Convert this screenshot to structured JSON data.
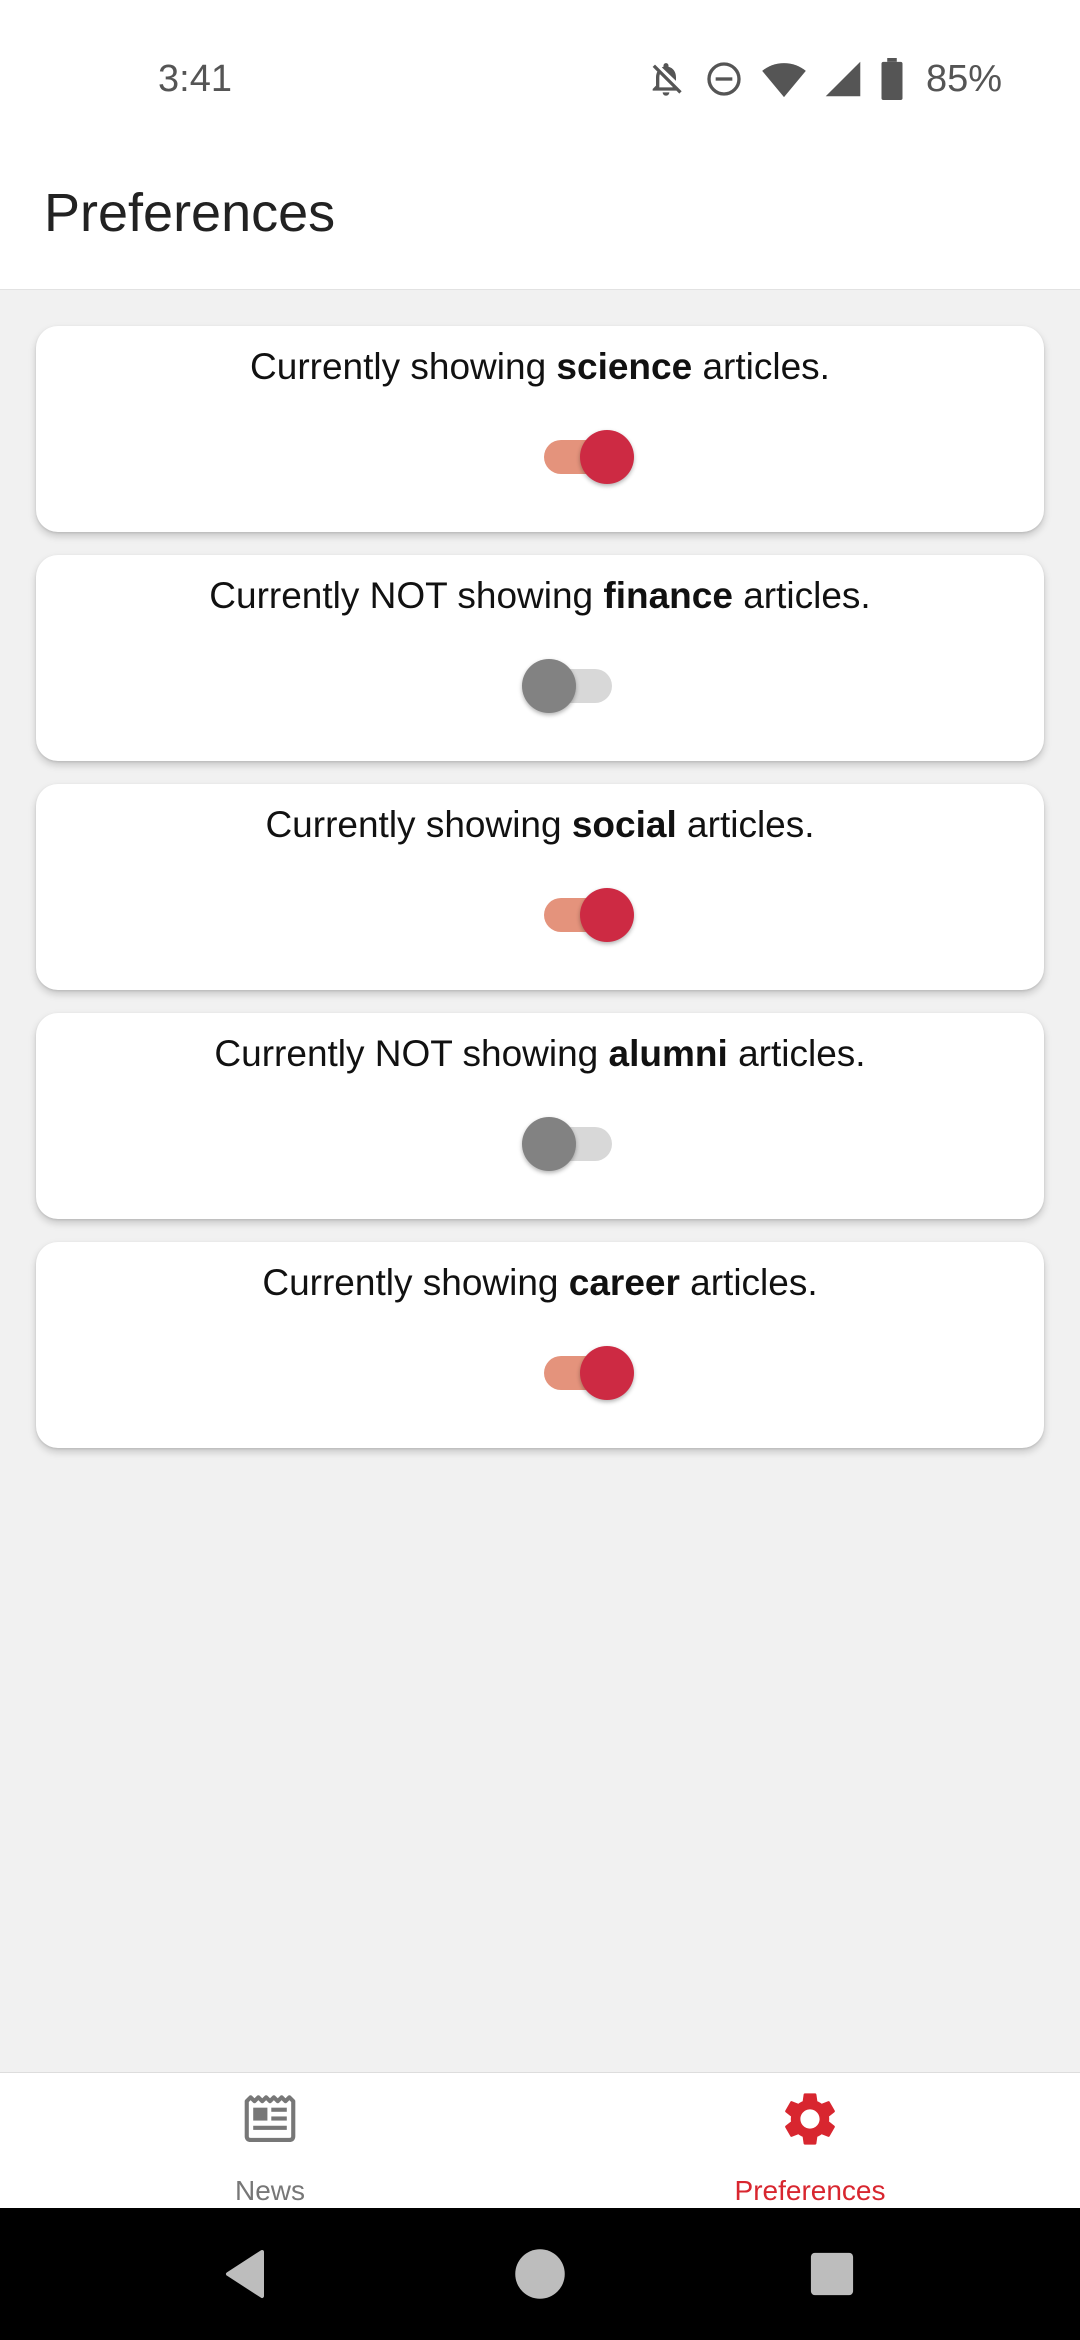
{
  "status_bar": {
    "time": "3:41",
    "battery": "85%",
    "icons": [
      "notifications-off-icon",
      "do-not-disturb-icon",
      "wifi-icon",
      "cell-signal-icon",
      "battery-icon"
    ]
  },
  "header": {
    "title": "Preferences"
  },
  "preferences": [
    {
      "prefix": "Currently showing ",
      "category": "science",
      "suffix": " articles.",
      "enabled": true
    },
    {
      "prefix": "Currently NOT showing ",
      "category": "finance",
      "suffix": " articles.",
      "enabled": false
    },
    {
      "prefix": "Currently showing ",
      "category": "social",
      "suffix": " articles.",
      "enabled": true
    },
    {
      "prefix": "Currently NOT showing ",
      "category": "alumni",
      "suffix": " articles.",
      "enabled": false
    },
    {
      "prefix": "Currently showing ",
      "category": "career",
      "suffix": " articles.",
      "enabled": true
    }
  ],
  "bottom_nav": {
    "items": [
      {
        "label": "News",
        "icon": "newspaper-icon",
        "active": false
      },
      {
        "label": "Preferences",
        "icon": "settings-gear-icon",
        "active": true
      }
    ]
  },
  "colors": {
    "accent": "#cd2a43",
    "active_nav": "#d8262f",
    "switch_track_on": "#e4937c",
    "switch_thumb_off": "#828282",
    "switch_track_off": "#d8d8d8"
  },
  "system_nav": {
    "buttons": [
      "back-icon",
      "home-icon",
      "recents-icon"
    ]
  }
}
